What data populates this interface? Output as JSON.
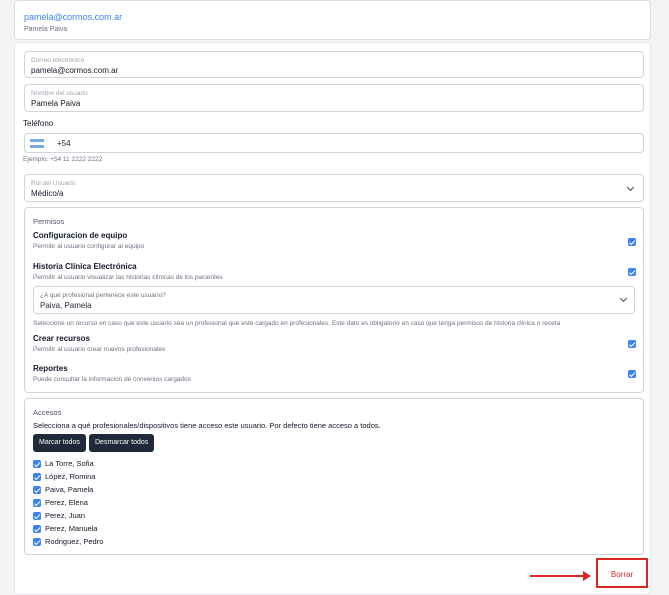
{
  "header": {
    "email": "pamela@cormos.com.ar",
    "name": "Pamela Paiva"
  },
  "form": {
    "email_label": "Correo electrónico",
    "email_value": "pamela@cormos.com.ar",
    "name_label": "Nombre del usuario",
    "name_value": "Pamela Paiva",
    "phone_label": "Teléfono",
    "phone_code": "+54",
    "phone_hint": "Ejemplo: +54 11 2222 2222",
    "role_label": "Rol del Usuario",
    "role_value": "Médico/a"
  },
  "permissions": {
    "title": "Permisos",
    "items": [
      {
        "title": "Configuracion de equipo",
        "desc": "Permitir al usuario configurar al equipo",
        "checked": true
      },
      {
        "title": "Historia Clínica Electrónica",
        "desc": "Permitir al usuario visualizar las historias clínicas de los pacientes",
        "checked": true
      },
      {
        "title": "Crear recursos",
        "desc": "Permitir al usuario crear nuevos profesionales",
        "checked": true
      },
      {
        "title": "Reportes",
        "desc": "Puede consultar la informacion de convenios cargados",
        "checked": true
      }
    ],
    "professional_label": "¿A qué profesional pertenece este usuario?",
    "professional_value": "Paiva, Pamela",
    "professional_hint": "Seleccione un recurso en caso que este usuario sea un profesional que este cargado en profesionales. Este dato es obligatorio en caso que tenga permisos de historia clinica o receta"
  },
  "access": {
    "title": "Accesos",
    "desc": "Selecciona a qué profesionales/dispositivos tiene acceso este usuario. Por defecto tiene acceso a todos.",
    "mark_all": "Marcar todos",
    "unmark_all": "Desmarcar todos",
    "items": [
      {
        "label": "La Torre, Sofia",
        "checked": true
      },
      {
        "label": "López, Romina",
        "checked": true
      },
      {
        "label": "Paiva, Pamela",
        "checked": true
      },
      {
        "label": "Perez, Elena",
        "checked": true
      },
      {
        "label": "Perez, Juan",
        "checked": true
      },
      {
        "label": "Perez, Manuela",
        "checked": true
      },
      {
        "label": "Rodriguez, Pedro",
        "checked": true
      }
    ]
  },
  "actions": {
    "delete_label": "Borrar"
  },
  "colors": {
    "accent": "#3b82f6",
    "highlight": "#dc2626"
  }
}
